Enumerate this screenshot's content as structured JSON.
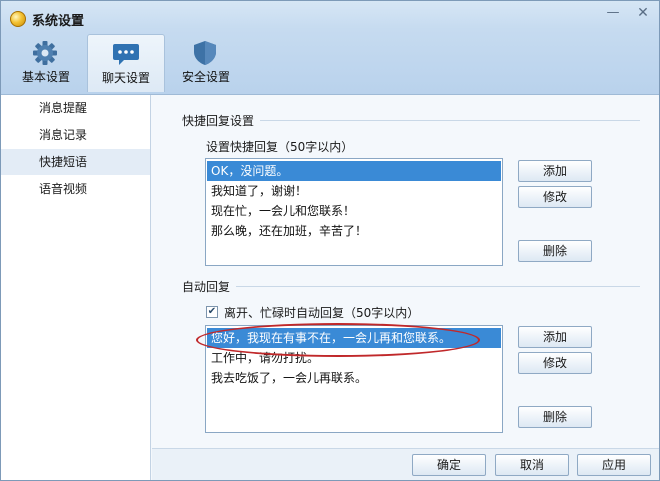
{
  "window": {
    "title": "系统设置",
    "min_glyph": "—",
    "close_glyph": "✕"
  },
  "tabs": [
    {
      "label": "基本设置",
      "icon": "gear-icon"
    },
    {
      "label": "聊天设置",
      "icon": "chat-bubble-icon",
      "active": true
    },
    {
      "label": "安全设置",
      "icon": "shield-icon"
    }
  ],
  "sidebar": {
    "items": [
      {
        "label": "消息提醒"
      },
      {
        "label": "消息记录"
      },
      {
        "label": "快捷短语",
        "active": true
      },
      {
        "label": "语音视频"
      }
    ]
  },
  "quick_reply": {
    "section_title": "快捷回复设置",
    "sub_label": "设置快捷回复（50字以内）",
    "items": [
      "OK，没问题。",
      "我知道了，谢谢！",
      "现在忙，一会儿和您联系！",
      "那么晚，还在加班，辛苦了！"
    ],
    "selected_index": 0,
    "add_label": "添加",
    "edit_label": "修改",
    "delete_label": "删除"
  },
  "auto_reply": {
    "section_title": "自动回复",
    "checkbox_label": "离开、忙碌时自动回复（50字以内）",
    "checkbox_checked": true,
    "check_glyph": "✔",
    "items": [
      "您好，我现在有事不在，一会儿再和您联系。",
      "工作中，请勿打扰。",
      "我去吃饭了，一会儿再联系。"
    ],
    "selected_index": 0,
    "add_label": "添加",
    "edit_label": "修改",
    "delete_label": "删除"
  },
  "footer": {
    "ok_label": "确定",
    "cancel_label": "取消",
    "apply_label": "应用"
  },
  "colors": {
    "selection": "#3a8ad6",
    "annotation": "#c0282a"
  }
}
